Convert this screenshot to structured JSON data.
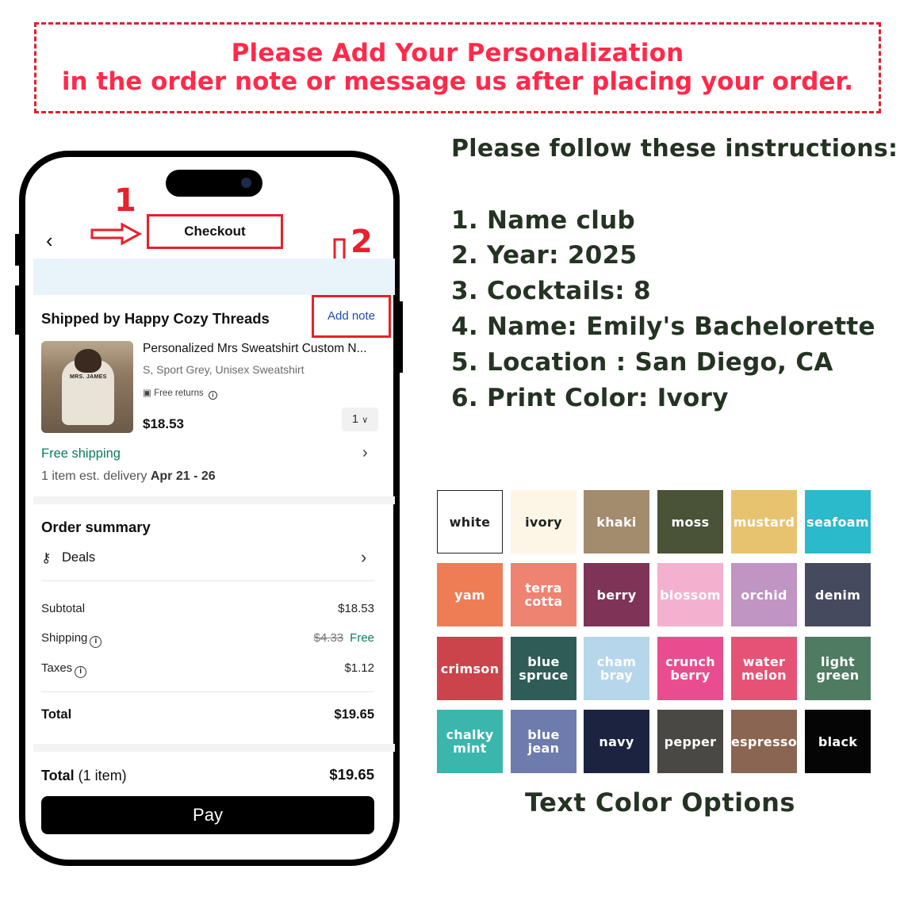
{
  "banner": {
    "line1": "Please Add Your Personalization",
    "line2": "in the order note or message us after placing your order."
  },
  "phone": {
    "step1": "1",
    "step2": "2",
    "title": "Checkout",
    "shipped_by": "Shipped by Happy Cozy Threads",
    "add_note": "Add note",
    "product": {
      "image_text": "MRS. JAMES",
      "title": "Personalized Mrs Sweatshirt Custom N...",
      "variant": "S, Sport Grey, Unisex Sweatshirt",
      "free_returns": "Free returns",
      "price": "$18.53",
      "qty": "1"
    },
    "free_shipping": "Free shipping",
    "delivery_prefix": "1 item est. delivery ",
    "delivery_dates": "Apr 21 - 26",
    "order_summary": "Order summary",
    "deals": "Deals",
    "rows": [
      {
        "label": "Subtotal",
        "value": "$18.53"
      },
      {
        "label": "Shipping",
        "old": "$4.33",
        "value": "Free"
      },
      {
        "label": "Taxes",
        "value": "$1.12"
      }
    ],
    "total_label": "Total",
    "total_value": "$19.65",
    "total_items_label": "Total",
    "total_items_count": " (1 item)",
    "total_items_value": "$19.65",
    "pay": "Pay"
  },
  "instructions": {
    "title": "Please follow these instructions:",
    "items": [
      "1. Name club",
      "2. Year: 2025",
      "3. Cocktails: 8",
      "4. Name: Emily's Bachelorette",
      "5. Location : San Diego, CA",
      "6. Print Color: Ivory"
    ]
  },
  "swatches": [
    {
      "label": "white",
      "bg": "#ffffff",
      "fg": "#222222"
    },
    {
      "label": "ivory",
      "bg": "#fdf6e6",
      "fg": "#222222"
    },
    {
      "label": "khaki",
      "bg": "#a38c6e",
      "fg": "#ffffff"
    },
    {
      "label": "moss",
      "bg": "#4a5237",
      "fg": "#ffffff"
    },
    {
      "label": "mustard",
      "bg": "#e8c36f",
      "fg": "#ffffff"
    },
    {
      "label": "seafoam",
      "bg": "#2bb9cc",
      "fg": "#ffffff"
    },
    {
      "label": "yam",
      "bg": "#ee7d55",
      "fg": "#ffffff"
    },
    {
      "label": "terra\ncotta",
      "bg": "#ee8371",
      "fg": "#ffffff"
    },
    {
      "label": "berry",
      "bg": "#7f3357",
      "fg": "#ffffff"
    },
    {
      "label": "blossom",
      "bg": "#f4b1cf",
      "fg": "#ffffff"
    },
    {
      "label": "orchid",
      "bg": "#c094c3",
      "fg": "#ffffff"
    },
    {
      "label": "denim",
      "bg": "#464a5f",
      "fg": "#ffffff"
    },
    {
      "label": "crimson",
      "bg": "#cb444b",
      "fg": "#ffffff"
    },
    {
      "label": "blue\nspruce",
      "bg": "#305c57",
      "fg": "#ffffff"
    },
    {
      "label": "cham\nbray",
      "bg": "#b6d6ec",
      "fg": "#ffffff"
    },
    {
      "label": "crunch\nberry",
      "bg": "#ea4d8f",
      "fg": "#ffffff"
    },
    {
      "label": "water\nmelon",
      "bg": "#e65276",
      "fg": "#ffffff"
    },
    {
      "label": "light\ngreen",
      "bg": "#4e7b61",
      "fg": "#ffffff"
    },
    {
      "label": "chalky\nmint",
      "bg": "#3bb6ad",
      "fg": "#ffffff"
    },
    {
      "label": "blue\njean",
      "bg": "#6e7bad",
      "fg": "#ffffff"
    },
    {
      "label": "navy",
      "bg": "#1b2340",
      "fg": "#ffffff"
    },
    {
      "label": "pepper",
      "bg": "#4a4845",
      "fg": "#ffffff"
    },
    {
      "label": "espresso",
      "bg": "#8a6551",
      "fg": "#ffffff"
    },
    {
      "label": "black",
      "bg": "#050505",
      "fg": "#ffffff"
    }
  ],
  "text_color_options": "Text Color Options"
}
